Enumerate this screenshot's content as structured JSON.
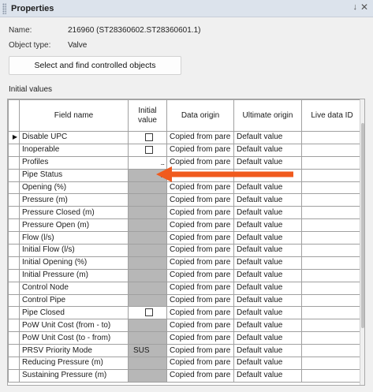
{
  "panel": {
    "title": "Properties",
    "pin_glyph": "↓",
    "close_glyph": "✕"
  },
  "info": {
    "name_label": "Name:",
    "name_value": "216960 (ST28360602.ST28360601.1)",
    "type_label": "Object type:",
    "type_value": "Valve"
  },
  "actions": {
    "select_button": "Select and find controlled objects"
  },
  "section": {
    "initial_values": "Initial values"
  },
  "grid": {
    "columns": {
      "field_name": "Field name",
      "initial_value_1": "Initial",
      "initial_value_2": "value",
      "data_origin": "Data origin",
      "ultimate_origin": "Ultimate origin",
      "live_data_id": "Live data ID"
    },
    "current_row_marker": "▶",
    "ellipsis": "...",
    "rows": [
      {
        "field": "Disable UPC",
        "initial": "",
        "data_origin": "Copied from pare",
        "ultimate_origin": "Default value"
      },
      {
        "field": "Inoperable",
        "initial": "",
        "data_origin": "Copied from pare",
        "ultimate_origin": "Default value"
      },
      {
        "field": "Profiles",
        "initial": "...",
        "data_origin": "Copied from pare",
        "ultimate_origin": "Default value"
      },
      {
        "field": "Pipe Status",
        "initial": "...",
        "data_origin": "",
        "ultimate_origin": ""
      },
      {
        "field": "Opening (%)",
        "initial": "",
        "data_origin": "Copied from pare",
        "ultimate_origin": "Default value"
      },
      {
        "field": "Pressure (m)",
        "initial": "",
        "data_origin": "Copied from pare",
        "ultimate_origin": "Default value"
      },
      {
        "field": "Pressure Closed (m)",
        "initial": "",
        "data_origin": "Copied from pare",
        "ultimate_origin": "Default value"
      },
      {
        "field": "Pressure Open (m)",
        "initial": "",
        "data_origin": "Copied from pare",
        "ultimate_origin": "Default value"
      },
      {
        "field": "Flow (l/s)",
        "initial": "",
        "data_origin": "Copied from pare",
        "ultimate_origin": "Default value"
      },
      {
        "field": "Initial Flow (l/s)",
        "initial": "",
        "data_origin": "Copied from pare",
        "ultimate_origin": "Default value"
      },
      {
        "field": "Initial Opening (%)",
        "initial": "",
        "data_origin": "Copied from pare",
        "ultimate_origin": "Default value"
      },
      {
        "field": "Initial Pressure (m)",
        "initial": "",
        "data_origin": "Copied from pare",
        "ultimate_origin": "Default value"
      },
      {
        "field": "Control Node",
        "initial": "",
        "data_origin": "Copied from pare",
        "ultimate_origin": "Default value"
      },
      {
        "field": "Control Pipe",
        "initial": "",
        "data_origin": "Copied from pare",
        "ultimate_origin": "Default value"
      },
      {
        "field": "Pipe Closed",
        "initial": "",
        "data_origin": "Copied from pare",
        "ultimate_origin": "Default value"
      },
      {
        "field": "PoW Unit Cost (from - to)",
        "initial": "",
        "data_origin": "Copied from pare",
        "ultimate_origin": "Default value"
      },
      {
        "field": "PoW Unit Cost (to - from)",
        "initial": "",
        "data_origin": "Copied from pare",
        "ultimate_origin": "Default value"
      },
      {
        "field": "PRSV Priority Mode",
        "initial": "SUS",
        "data_origin": "Copied from pare",
        "ultimate_origin": "Default value"
      },
      {
        "field": "Reducing Pressure (m)",
        "initial": "",
        "data_origin": "Copied from pare",
        "ultimate_origin": "Default value"
      },
      {
        "field": "Sustaining Pressure (m)",
        "initial": "",
        "data_origin": "Copied from pare",
        "ultimate_origin": "Default value"
      }
    ]
  },
  "colors": {
    "annotation_arrow": "#f05a1e",
    "disabled_cell": "#b7b7b7"
  }
}
